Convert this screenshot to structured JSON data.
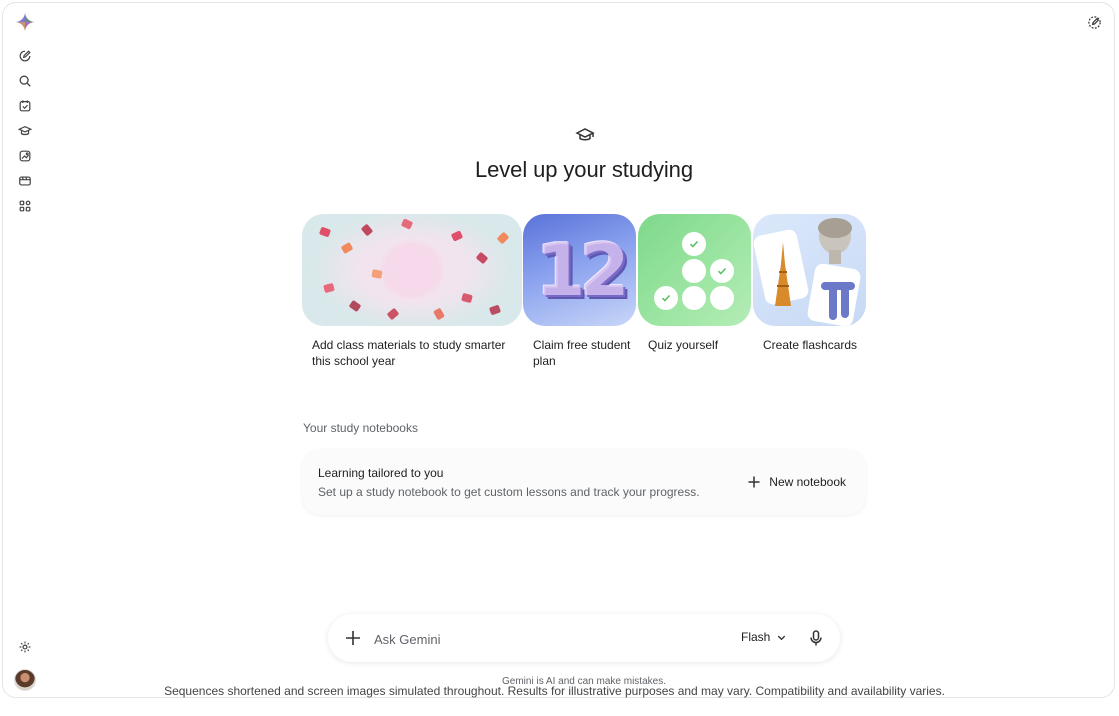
{
  "hero": {
    "title": "Level up your studying",
    "icon": "graduation-cap-icon"
  },
  "sidebar": {
    "items": [
      {
        "icon": "new-chat-icon"
      },
      {
        "icon": "search-icon"
      },
      {
        "icon": "tasks-icon"
      },
      {
        "icon": "learning-icon"
      },
      {
        "icon": "gallery-icon"
      },
      {
        "icon": "video-icon"
      },
      {
        "icon": "apps-icon"
      }
    ],
    "settings_icon": "gear-icon",
    "avatar_icon": "avatar"
  },
  "cards": [
    {
      "label": "Add class materials to study smarter this school year"
    },
    {
      "label": "Claim free student plan",
      "image_text": "12"
    },
    {
      "label": "Quiz yourself"
    },
    {
      "label": "Create flashcards"
    }
  ],
  "notebooks": {
    "heading": "Your study notebooks",
    "card_title": "Learning tailored to you",
    "card_subtitle": "Set up a study notebook to get custom lessons and track your progress.",
    "new_button": "New notebook"
  },
  "input": {
    "placeholder": "Ask Gemini",
    "model": "Flash"
  },
  "footer": {
    "disclaimer": "Gemini is AI and can make mistakes.",
    "caption": "Sequences shortened and screen images simulated throughout. Results for illustrative purposes and may vary. Compatibility and availability varies."
  },
  "colors": {
    "accent_blue": "#4285f4",
    "quiz_green": "#8fdd96",
    "text": "#1f1f1f",
    "muted": "#5f6368"
  }
}
